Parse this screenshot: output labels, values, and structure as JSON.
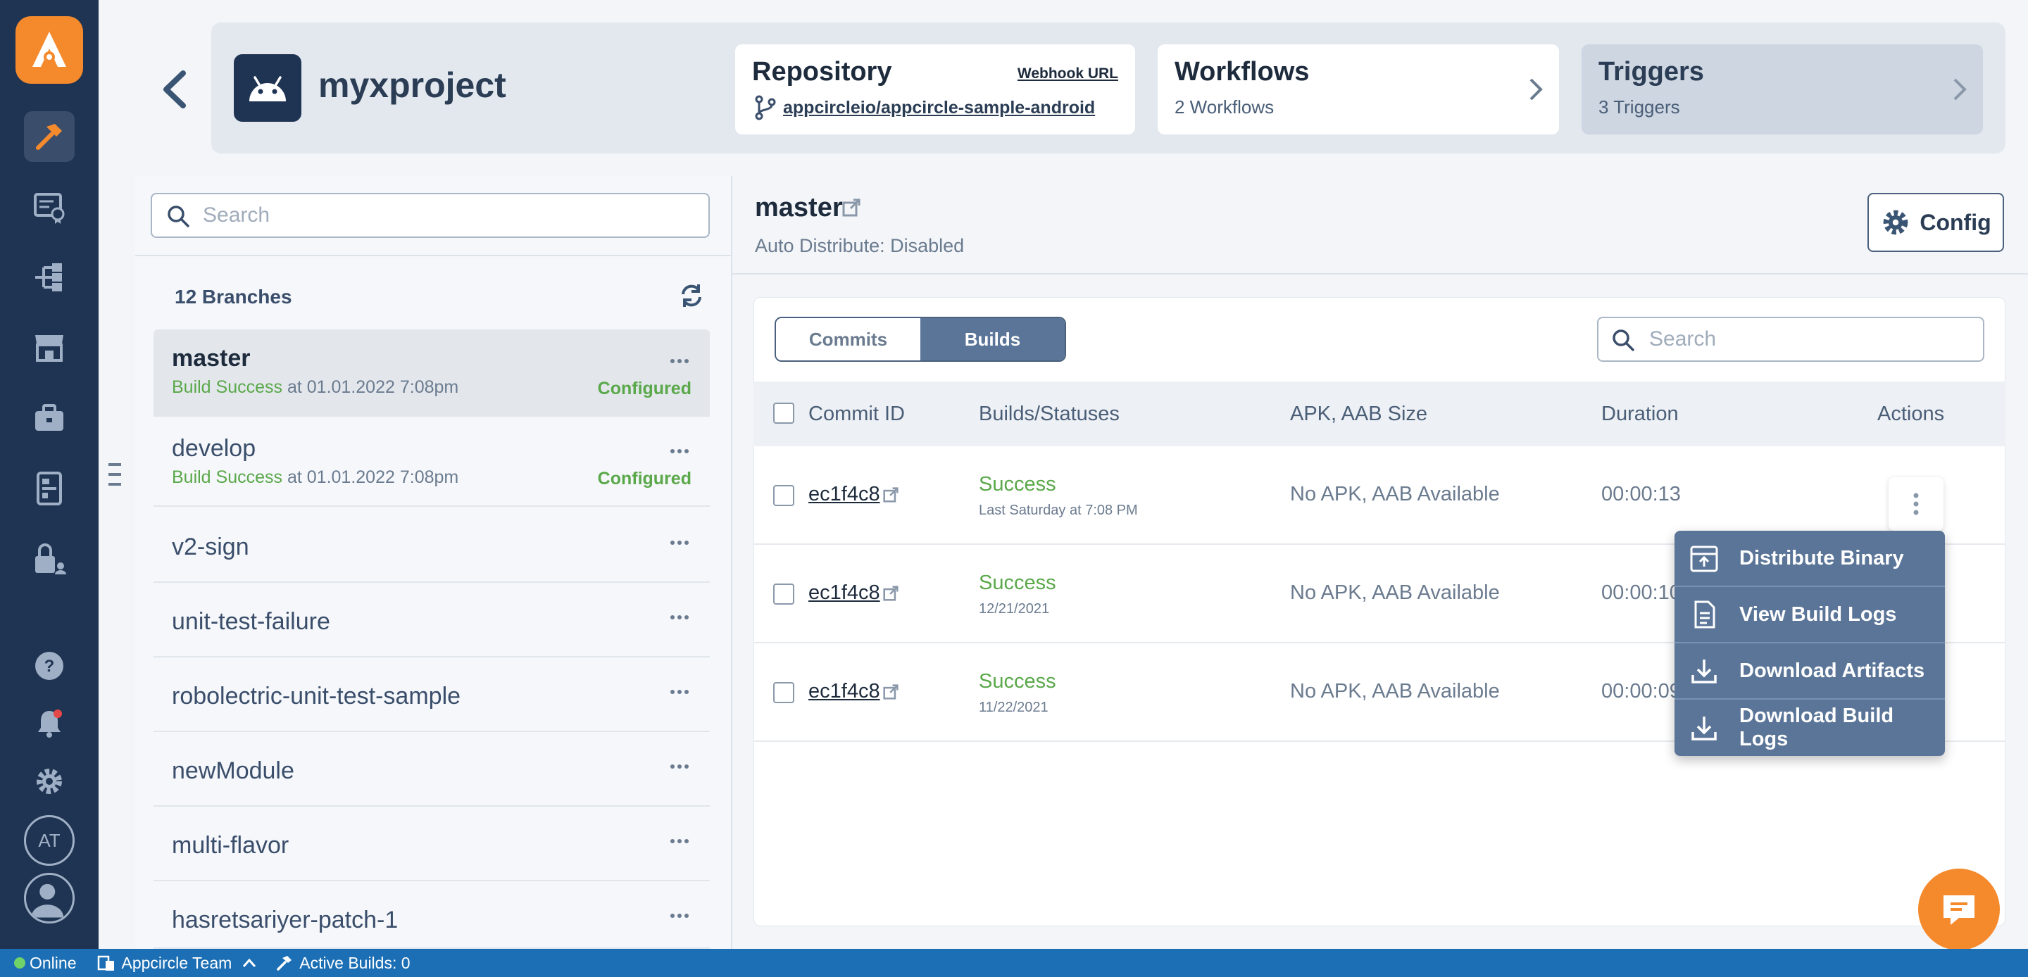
{
  "colors": {
    "accent": "#f58a2d",
    "rail": "#1f3452",
    "success": "#5aa84a",
    "statusbar": "#1c6fb4",
    "menu": "#5a7598"
  },
  "rail": {
    "items": [
      "build-icon",
      "testing-icon",
      "distribution-icon",
      "store-icon",
      "enterprise-icon",
      "publish-icon",
      "signing-icon"
    ],
    "bottom": {
      "help": "help-icon",
      "notifications": "bell-icon",
      "settings": "gear-icon",
      "initials": "AT",
      "profile": "user-icon"
    }
  },
  "header": {
    "project_name": "myxproject",
    "repository": {
      "title": "Repository",
      "webhook_label": "Webhook URL",
      "repo_link": "appcircleio/appcircle-sample-android"
    },
    "workflows": {
      "title": "Workflows",
      "subtitle": "2 Workflows"
    },
    "triggers": {
      "title": "Triggers",
      "subtitle": "3 Triggers"
    }
  },
  "branches": {
    "search_placeholder": "Search",
    "count_label": "12 Branches",
    "items": [
      {
        "name": "master",
        "status_ok": "Build Success",
        "status_rest": " at 01.01.2022 7:08pm",
        "configured": "Configured"
      },
      {
        "name": "develop",
        "status_ok": "Build Success",
        "status_rest": " at 01.01.2022 7:08pm",
        "configured": "Configured"
      },
      {
        "name": "v2-sign"
      },
      {
        "name": "unit-test-failure"
      },
      {
        "name": "robolectric-unit-test-sample"
      },
      {
        "name": "newModule"
      },
      {
        "name": "multi-flavor"
      },
      {
        "name": "hasretsariyer-patch-1"
      }
    ]
  },
  "main": {
    "branch_title": "master",
    "auto_distribute": "Auto Distribute: Disabled",
    "config_label": "Config",
    "tabs": [
      "Commits",
      "Builds"
    ],
    "search_placeholder": "Search",
    "columns": [
      "Commit ID",
      "Builds/Statuses",
      "APK, AAB Size",
      "Duration",
      "Actions"
    ],
    "rows": [
      {
        "commit": "ec1f4c8",
        "status": "Success",
        "date": "Last Saturday at 7:08 PM",
        "size": "No APK, AAB Available",
        "duration": "00:00:13"
      },
      {
        "commit": "ec1f4c8",
        "status": "Success",
        "date": "12/21/2021",
        "size": "No APK, AAB Available",
        "duration": "00:00:10"
      },
      {
        "commit": "ec1f4c8",
        "status": "Success",
        "date": "11/22/2021",
        "size": "No APK, AAB Available",
        "duration": "00:00:09"
      }
    ],
    "menu": [
      "Distribute Binary",
      "View Build Logs",
      "Download Artifacts",
      "Download Build Logs"
    ]
  },
  "statusbar": {
    "online": "Online",
    "team": "Appcircle Team",
    "active_builds": "Active Builds: 0"
  }
}
